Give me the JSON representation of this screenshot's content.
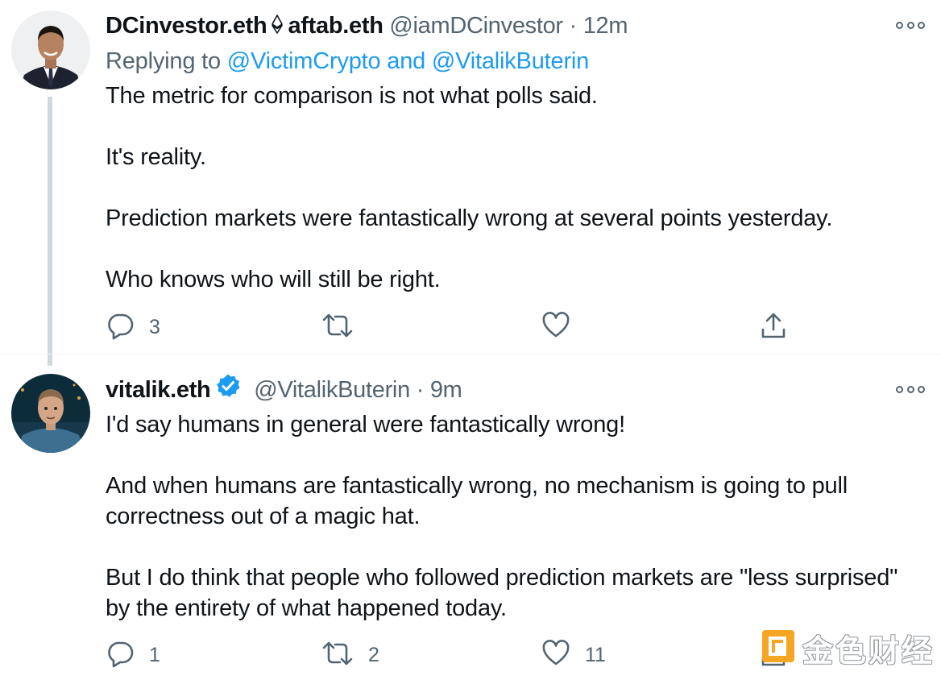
{
  "tweets": [
    {
      "display_name": "DCinvestor.eth",
      "display_name_suffix": "aftab.eth",
      "handle": "@iamDCinvestor",
      "separator": "·",
      "time": "12m",
      "replying_prefix": "Replying to",
      "replying_to": "@VictimCrypto and @VitalikButerin",
      "paragraphs": [
        "The metric for comparison is not what polls said.",
        "It's reality.",
        "Prediction markets were fantastically wrong at several points yesterday.",
        "Who knows who will still be right."
      ],
      "replies": "3",
      "retweets": "",
      "likes": ""
    },
    {
      "display_name": "vitalik.eth",
      "handle": "@VitalikButerin",
      "separator": "·",
      "time": "9m",
      "paragraphs": [
        "I'd say humans in general were fantastically wrong!",
        "And when humans are fantastically wrong, no mechanism is going to pull correctness out of a magic hat.",
        "But I do think that people who followed prediction markets are \"less surprised\" by the entirety of what happened today."
      ],
      "replies": "1",
      "retweets": "2",
      "likes": "11"
    }
  ],
  "watermark": {
    "text": "金色财经",
    "color": "#f5a623"
  },
  "colors": {
    "text": "#0f1419",
    "secondary": "#536471",
    "link": "#1d9bf0",
    "thread_line": "#cfd9de"
  },
  "icons": {
    "reply": "reply-icon",
    "retweet": "retweet-icon",
    "like": "heart-icon",
    "share": "share-icon",
    "more": "more-dots-icon",
    "verified": "verified-badge-icon",
    "eth": "ethereum-icon"
  }
}
